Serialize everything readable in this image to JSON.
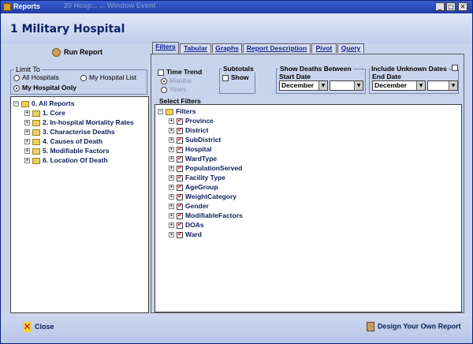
{
  "window": {
    "title": "Reports",
    "ghost_title": "20 Hosp...  ...  Window Event",
    "minimize": "_",
    "maximize": "□",
    "close": "✕"
  },
  "header": {
    "hospital": "1 Military Hospital"
  },
  "left": {
    "run_report": "Run Report",
    "limit_to": "Limit To",
    "options": [
      {
        "label": "All Hospitals",
        "selected": false
      },
      {
        "label": "My Hospital List",
        "selected": false
      },
      {
        "label": "My Hospital Only",
        "selected": true
      }
    ],
    "tree_root": "0. All Reports",
    "tree_items": [
      "1. Core",
      "2. In-hospital Mortality Rates",
      "3. Characterise Deaths",
      "4. Causes of Death",
      "5. Modifiable Factors",
      "6. Location Of Death"
    ]
  },
  "tabs": [
    "Filters",
    "Tabular",
    "Graphs",
    "Report Description",
    "Pivot",
    "Query"
  ],
  "filters": {
    "time_trend": "Time Trend",
    "months": "Months",
    "years": "Years",
    "subtotals": "Subtotals",
    "show": "Show",
    "show_deaths_between": "Show Deaths Between",
    "start_date": "Start Date",
    "start_month": "December",
    "start_year": "",
    "include_unknown_dates": "Include Unknown Dates",
    "end_date": "End Date",
    "end_month": "December",
    "end_year": "",
    "select_filters": "Select Filters",
    "filter_root": "Filters",
    "filter_items": [
      "Province",
      "District",
      "SubDistrict",
      "Hospital",
      "WardType",
      "PopulationServed",
      "Facility Type",
      "AgeGroup",
      "WeightCategory",
      "Gender",
      "ModifiableFactors",
      "DOAs",
      "Ward"
    ]
  },
  "footer": {
    "close": "Close",
    "design": "Design Your Own Report"
  }
}
